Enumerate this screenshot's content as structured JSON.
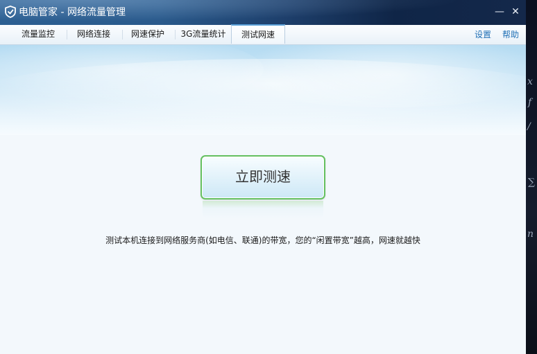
{
  "window": {
    "title": "电脑管家 - 网络流量管理",
    "minimize_label": "—",
    "close_label": "✕"
  },
  "tabs": [
    {
      "label": "流量监控"
    },
    {
      "label": "网络连接"
    },
    {
      "label": "网速保护"
    },
    {
      "label": "3G流量统计"
    },
    {
      "label": "测试网速"
    }
  ],
  "active_tab": "测试网速",
  "toplinks": {
    "settings": "设置",
    "help": "帮助"
  },
  "main": {
    "test_button_label": "立即测速",
    "description": "测试本机连接到网络服务商(如电信、联通)的带宽，您的“闲置带宽”越高，网速就越快"
  },
  "icons": {
    "app_logo": "shield-logo-icon",
    "minimize": "minimize-icon",
    "close": "close-icon"
  },
  "colors": {
    "titlebar": "#2a5a8c",
    "accent_link": "#1f6fb5",
    "button_border": "#64c060"
  }
}
